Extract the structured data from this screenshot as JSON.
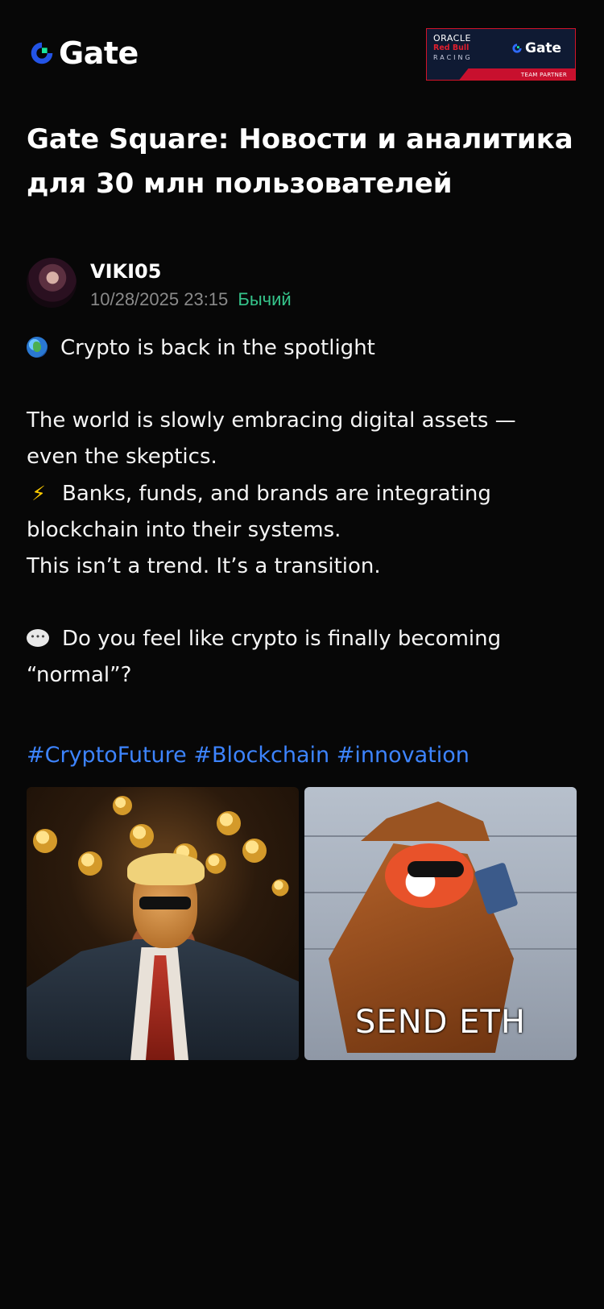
{
  "header": {
    "logo_text": "Gate",
    "partner_badge": {
      "oracle": "ORACLE",
      "redbull": "Red Bull",
      "racing": "RACING",
      "gate": "Gate",
      "partner": "TEAM PARTNER"
    }
  },
  "page_title": "Gate Square: Новости и аналитика для 30 млн пользователей",
  "post": {
    "author": "VIKI05",
    "timestamp": "10/28/2025 23:15",
    "sentiment": "Бычий",
    "body": {
      "line1": "Crypto is back in the spotlight",
      "para2_line1": "The world is slowly embracing digital assets —",
      "para2_line2": "even the skeptics.",
      "para3_line1": "Banks, funds, and brands are integrating",
      "para3_line2": "blockchain into their systems.",
      "para3_line3": "This isn’t a trend. It’s a transition.",
      "para4_line1": "Do you feel like crypto is finally becoming",
      "para4_line2": "“normal”?"
    },
    "emojis": [
      "globe",
      "lightning",
      "speech-balloon"
    ],
    "hashtags": [
      "#CryptoFuture",
      "#Blockchain",
      "#innovation"
    ],
    "images": [
      {
        "name": "coins-portrait-image"
      },
      {
        "name": "send-eth-meme-image",
        "caption": "SEND ETH"
      }
    ]
  },
  "colors": {
    "background": "#070707",
    "text": "#ffffff",
    "muted": "#8a8a8a",
    "bullish": "#35c48b",
    "hashtag": "#3d84ff",
    "brand_blue": "#2354e6",
    "brand_green": "#17e5a0"
  }
}
